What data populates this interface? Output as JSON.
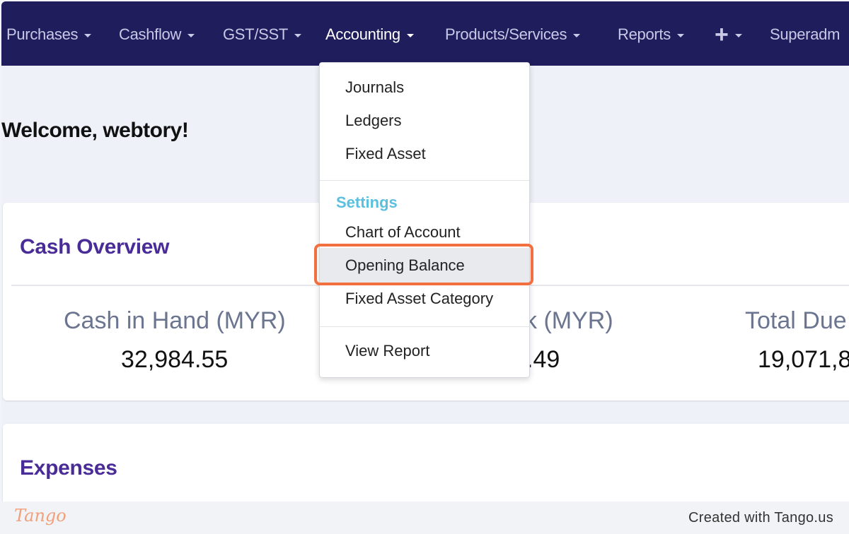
{
  "nav": {
    "items": [
      {
        "label": "Purchases"
      },
      {
        "label": "Cashflow"
      },
      {
        "label": "GST/SST"
      },
      {
        "label": "Accounting"
      },
      {
        "label": "Products/Services"
      },
      {
        "label": "Reports"
      },
      {
        "label": "+"
      },
      {
        "label": "Superadm"
      }
    ]
  },
  "welcome": "Welcome, webtory!",
  "cash_overview": {
    "title": "Cash Overview",
    "stats": [
      {
        "label": "Cash in Hand (MYR)",
        "value": "32,984.55"
      },
      {
        "label": "k (MYR)",
        "value": ".49"
      },
      {
        "label": "Total Due",
        "value": "19,071,8"
      }
    ]
  },
  "expenses": {
    "title": "Expenses"
  },
  "accounting_menu": {
    "items": [
      "Journals",
      "Ledgers",
      "Fixed Asset"
    ],
    "settings_header": "Settings",
    "settings_items": [
      "Chart of Account",
      "Opening Balance",
      "Fixed Asset Category"
    ],
    "report_item": "View Report"
  },
  "footer": {
    "logo": "Tango",
    "created_with": "Created with Tango.us"
  }
}
